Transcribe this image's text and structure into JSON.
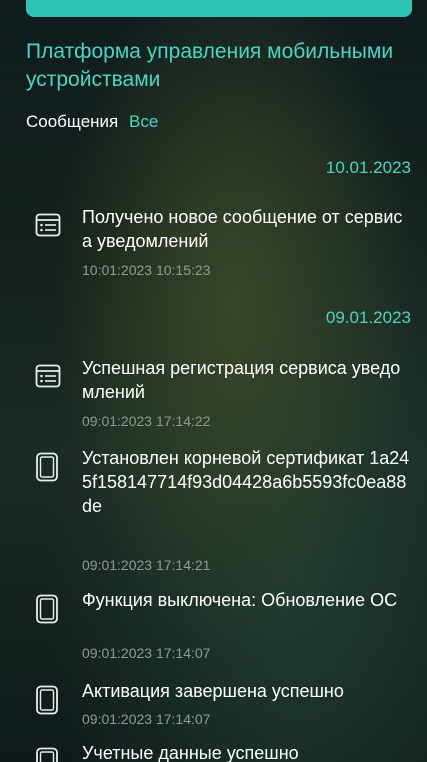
{
  "app": {
    "title": "Платформа управления мобильными устройствами"
  },
  "breadcrumb": {
    "section": "Сообщения",
    "filter": "Все"
  },
  "groups": [
    {
      "date": "10.01.2023",
      "messages": [
        {
          "icon": "list-icon",
          "text": "Получено новое сообщение от сервиса уведомлений",
          "time": "10:01:2023 10:15:23"
        }
      ]
    },
    {
      "date": "09.01.2023",
      "messages": [
        {
          "icon": "list-icon",
          "text": "Успешная регистрация сервиса уведомлений",
          "time": "09:01:2023 17:14:22"
        },
        {
          "icon": "device-icon",
          "text": "Установлен корневой сертификат 1a245f158147714f93d04428a6b5593fc0ea88de",
          "time": "09:01:2023 17:14:21"
        },
        {
          "icon": "device-icon",
          "text": "Функция выключена: Обновление ОС",
          "time": "09:01:2023 17:14:07"
        },
        {
          "icon": "device-icon",
          "text": "Активация завершена успешно",
          "time": "09:01:2023 17:14:07"
        },
        {
          "icon": "device-icon",
          "text": "Учетные данные успешно",
          "time": ""
        }
      ]
    }
  ],
  "colors": {
    "accent": "#49d6c3",
    "topbar": "#2fc3b2",
    "muted": "#8f9a96"
  }
}
